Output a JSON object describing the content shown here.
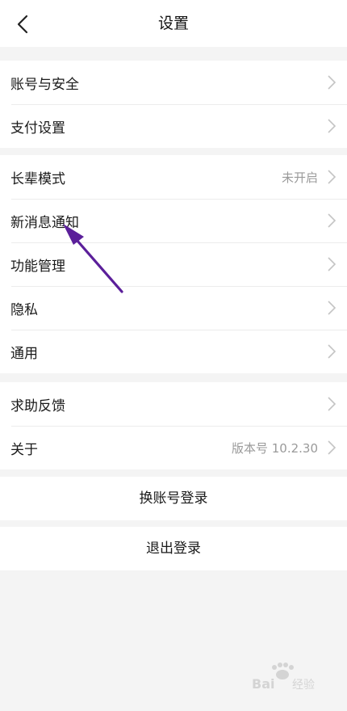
{
  "header": {
    "title": "设置",
    "back_icon": "chevron-left-icon"
  },
  "groups": [
    {
      "items": [
        {
          "label": "账号与安全"
        },
        {
          "label": "支付设置"
        }
      ]
    },
    {
      "items": [
        {
          "label": "长辈模式",
          "value": "未开启"
        },
        {
          "label": "新消息通知"
        },
        {
          "label": "功能管理"
        },
        {
          "label": "隐私"
        },
        {
          "label": "通用"
        }
      ]
    },
    {
      "items": [
        {
          "label": "求助反馈"
        },
        {
          "label": "关于",
          "value": "版本号 10.2.30"
        }
      ]
    }
  ],
  "actions": {
    "switch_account": "换账号登录",
    "logout": "退出登录"
  },
  "annotation": {
    "color": "#5b1f9a",
    "icon": "arrow-pointer"
  },
  "colors": {
    "background": "#f4f4f4",
    "card": "#ffffff",
    "chevron": "#c4c4c4",
    "secondary_text": "#9a9a9a"
  }
}
